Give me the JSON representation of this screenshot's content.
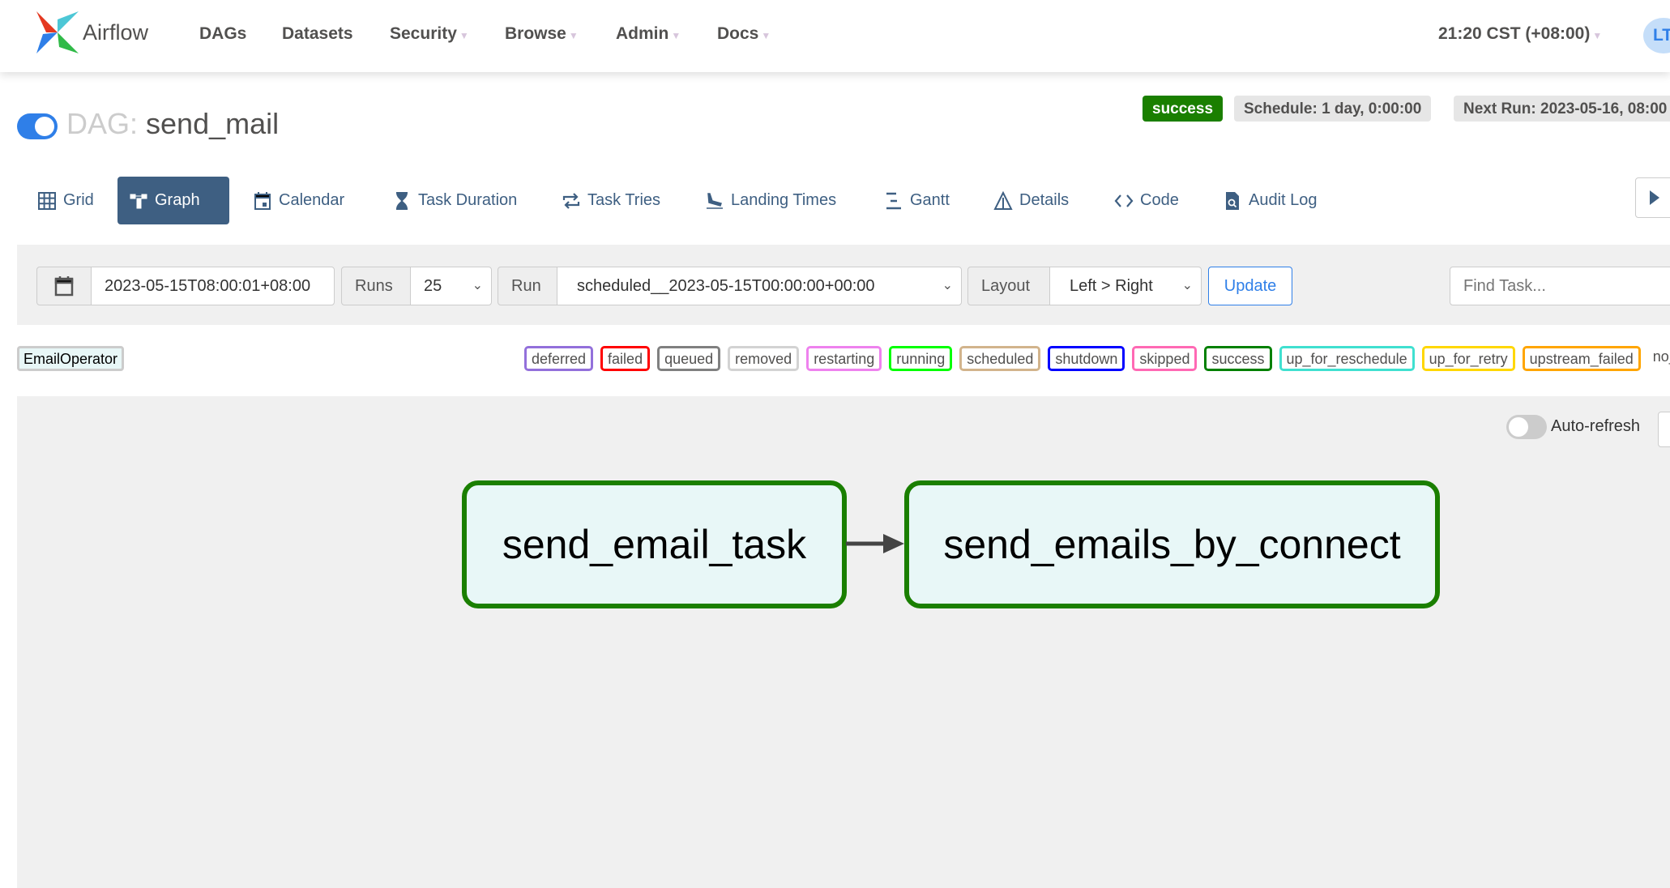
{
  "navbar": {
    "brand": "Airflow",
    "items": [
      {
        "label": "DAGs",
        "dropdown": false
      },
      {
        "label": "Datasets",
        "dropdown": false
      },
      {
        "label": "Security",
        "dropdown": true
      },
      {
        "label": "Browse",
        "dropdown": true
      },
      {
        "label": "Admin",
        "dropdown": true
      },
      {
        "label": "Docs",
        "dropdown": true
      }
    ],
    "time": "21:20 CST (+08:00)",
    "avatar": "LT"
  },
  "dag": {
    "prefix": "DAG:",
    "name": "send_mail",
    "paused": false,
    "status": "success",
    "schedule": "Schedule: 1 day, 0:00:00",
    "next_run": "Next Run: 2023-05-16, 08:00"
  },
  "tabs": [
    {
      "label": "Grid",
      "icon": "grid-icon"
    },
    {
      "label": "Graph",
      "icon": "graph-icon",
      "active": true
    },
    {
      "label": "Calendar",
      "icon": "calendar-icon"
    },
    {
      "label": "Task Duration",
      "icon": "hourglass-icon"
    },
    {
      "label": "Task Tries",
      "icon": "retry-icon"
    },
    {
      "label": "Landing Times",
      "icon": "plane-landing-icon"
    },
    {
      "label": "Gantt",
      "icon": "gantt-icon"
    },
    {
      "label": "Details",
      "icon": "warning-triangle-icon"
    },
    {
      "label": "Code",
      "icon": "code-icon"
    },
    {
      "label": "Audit Log",
      "icon": "file-search-icon"
    }
  ],
  "filters": {
    "base_date": "2023-05-15T08:00:01+08:00",
    "runs_label": "Runs",
    "runs_value": "25",
    "run_label": "Run",
    "run_value": "scheduled__2023-05-15T00:00:00+00:00",
    "layout_label": "Layout",
    "layout_value": "Left > Right",
    "update": "Update",
    "find_placeholder": "Find Task..."
  },
  "legend": {
    "operator": "EmailOperator",
    "states": [
      {
        "label": "deferred",
        "color": "#9370db"
      },
      {
        "label": "failed",
        "color": "#ff0000"
      },
      {
        "label": "queued",
        "color": "#808080"
      },
      {
        "label": "removed",
        "color": "#d3d3d3"
      },
      {
        "label": "restarting",
        "color": "#ee82ee"
      },
      {
        "label": "running",
        "color": "#00ff00"
      },
      {
        "label": "scheduled",
        "color": "#d2b48c"
      },
      {
        "label": "shutdown",
        "color": "#0000ff"
      },
      {
        "label": "skipped",
        "color": "#ff69b4"
      },
      {
        "label": "success",
        "color": "#008000"
      },
      {
        "label": "up_for_reschedule",
        "color": "#40e0d0"
      },
      {
        "label": "up_for_retry",
        "color": "#ffd700"
      },
      {
        "label": "upstream_failed",
        "color": "#ffa500"
      },
      {
        "label": "no_status",
        "color": "#ffffff"
      }
    ]
  },
  "graph": {
    "auto_refresh": "Auto-refresh",
    "auto_refresh_on": false,
    "nodes": [
      {
        "label": "send_email_task"
      },
      {
        "label": "send_emails_by_connect"
      }
    ],
    "edges": [
      [
        "send_email_task",
        "send_emails_by_connect"
      ]
    ]
  }
}
